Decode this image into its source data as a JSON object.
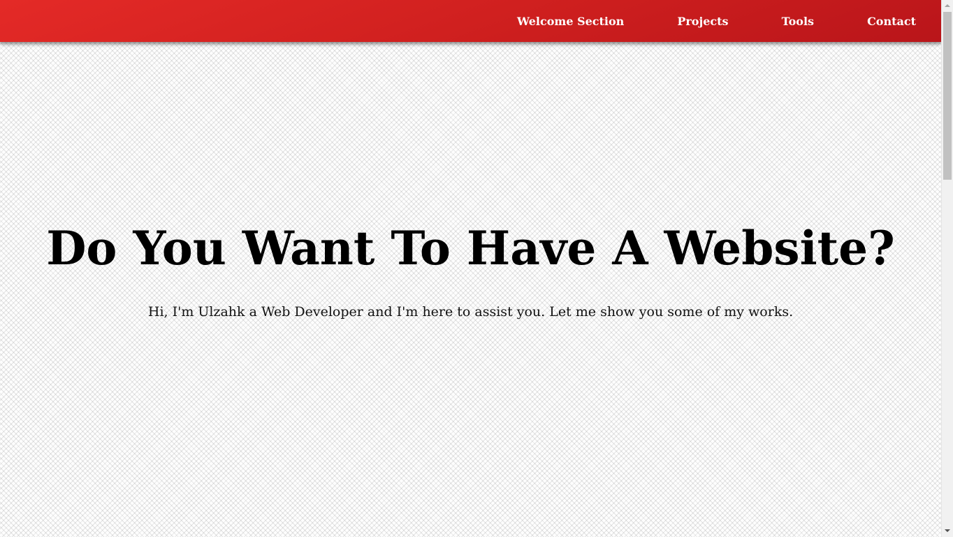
{
  "nav": {
    "items": [
      {
        "label": "Welcome Section"
      },
      {
        "label": "Projects"
      },
      {
        "label": "Tools"
      },
      {
        "label": "Contact"
      }
    ]
  },
  "welcome": {
    "headline": "Do You Want To Have A Website?",
    "intro": "Hi, I'm Ulzahk a Web Developer and I'm here to assist you. Let me show you some of my works."
  },
  "colors": {
    "navbar_accent": "#d0201f",
    "nav_text": "#ffffff",
    "headline_text": "#000000"
  }
}
